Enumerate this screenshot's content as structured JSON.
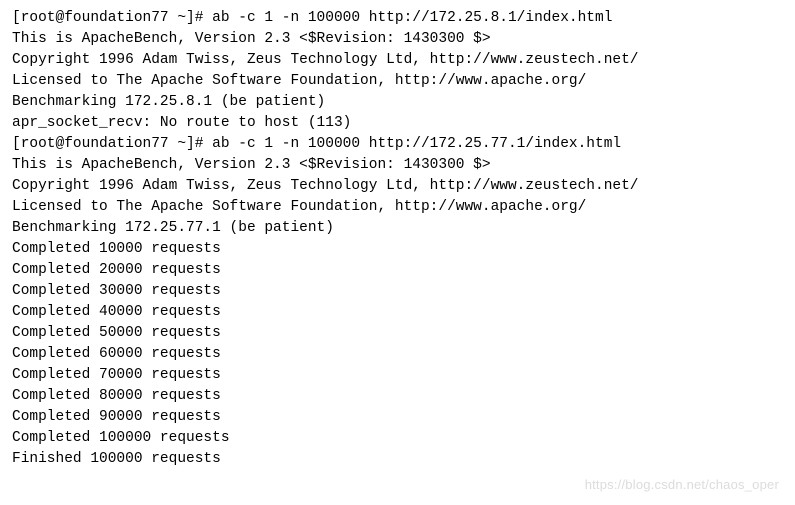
{
  "lines": [
    "[root@foundation77 ~]# ab -c 1 -n 100000 http://172.25.8.1/index.html",
    "This is ApacheBench, Version 2.3 <$Revision: 1430300 $>",
    "Copyright 1996 Adam Twiss, Zeus Technology Ltd, http://www.zeustech.net/",
    "Licensed to The Apache Software Foundation, http://www.apache.org/",
    "",
    "Benchmarking 172.25.8.1 (be patient)",
    "apr_socket_recv: No route to host (113)",
    "[root@foundation77 ~]# ab -c 1 -n 100000 http://172.25.77.1/index.html",
    "This is ApacheBench, Version 2.3 <$Revision: 1430300 $>",
    "Copyright 1996 Adam Twiss, Zeus Technology Ltd, http://www.zeustech.net/",
    "Licensed to The Apache Software Foundation, http://www.apache.org/",
    "",
    "Benchmarking 172.25.77.1 (be patient)",
    "Completed 10000 requests",
    "Completed 20000 requests",
    "Completed 30000 requests",
    "Completed 40000 requests",
    "Completed 50000 requests",
    "Completed 60000 requests",
    "Completed 70000 requests",
    "Completed 80000 requests",
    "Completed 90000 requests",
    "Completed 100000 requests",
    "Finished 100000 requests"
  ],
  "watermark": "https://blog.csdn.net/chaos_oper"
}
